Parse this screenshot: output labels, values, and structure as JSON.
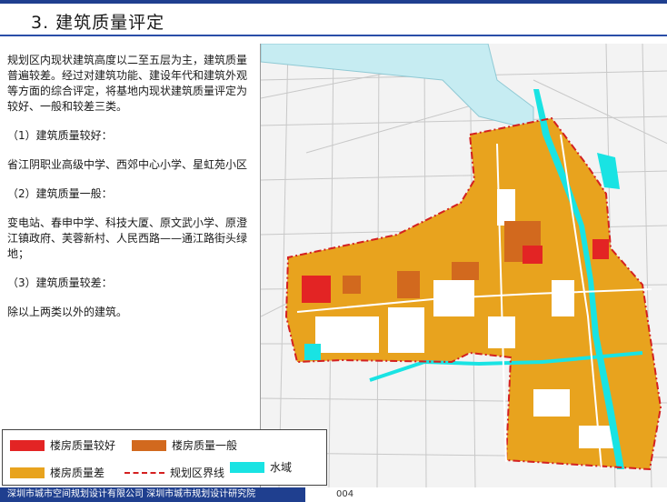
{
  "header": {
    "title": "3. 建筑质量评定"
  },
  "body": {
    "intro": "规划区内现状建筑高度以二至五层为主，建筑质量普遍较差。经过对建筑功能、建设年代和建筑外观等方面的综合评定，将基地内现状建筑质量评定为较好、一般和较差三类。",
    "good_heading": "（1）建筑质量较好：",
    "good_text": "省江阴职业高级中学、西郊中心小学、星虹苑小区",
    "medium_heading": "（2）建筑质量一般：",
    "medium_text": "变电站、春申中学、科技大厦、原文武小学、原澄江镇政府、芙蓉新村、人民西路——通江路街头绿地；",
    "poor_heading": "（3）建筑质量较差：",
    "poor_text": "除以上两类以外的建筑。"
  },
  "legend": {
    "good": "楼房质量较好",
    "medium": "楼房质量一般",
    "poor": "楼房质量差",
    "boundary": "规划区界线",
    "water": "水域"
  },
  "colors": {
    "good": "#e32424",
    "medium": "#d2691e",
    "poor": "#e8a31e",
    "water": "#19e3e3",
    "boundary": "#d42020",
    "brand": "#1f3f8f"
  },
  "footer": {
    "org": "深圳市城市空间规划设计有限公司  深圳市城市规划设计研究院",
    "page": "004"
  }
}
